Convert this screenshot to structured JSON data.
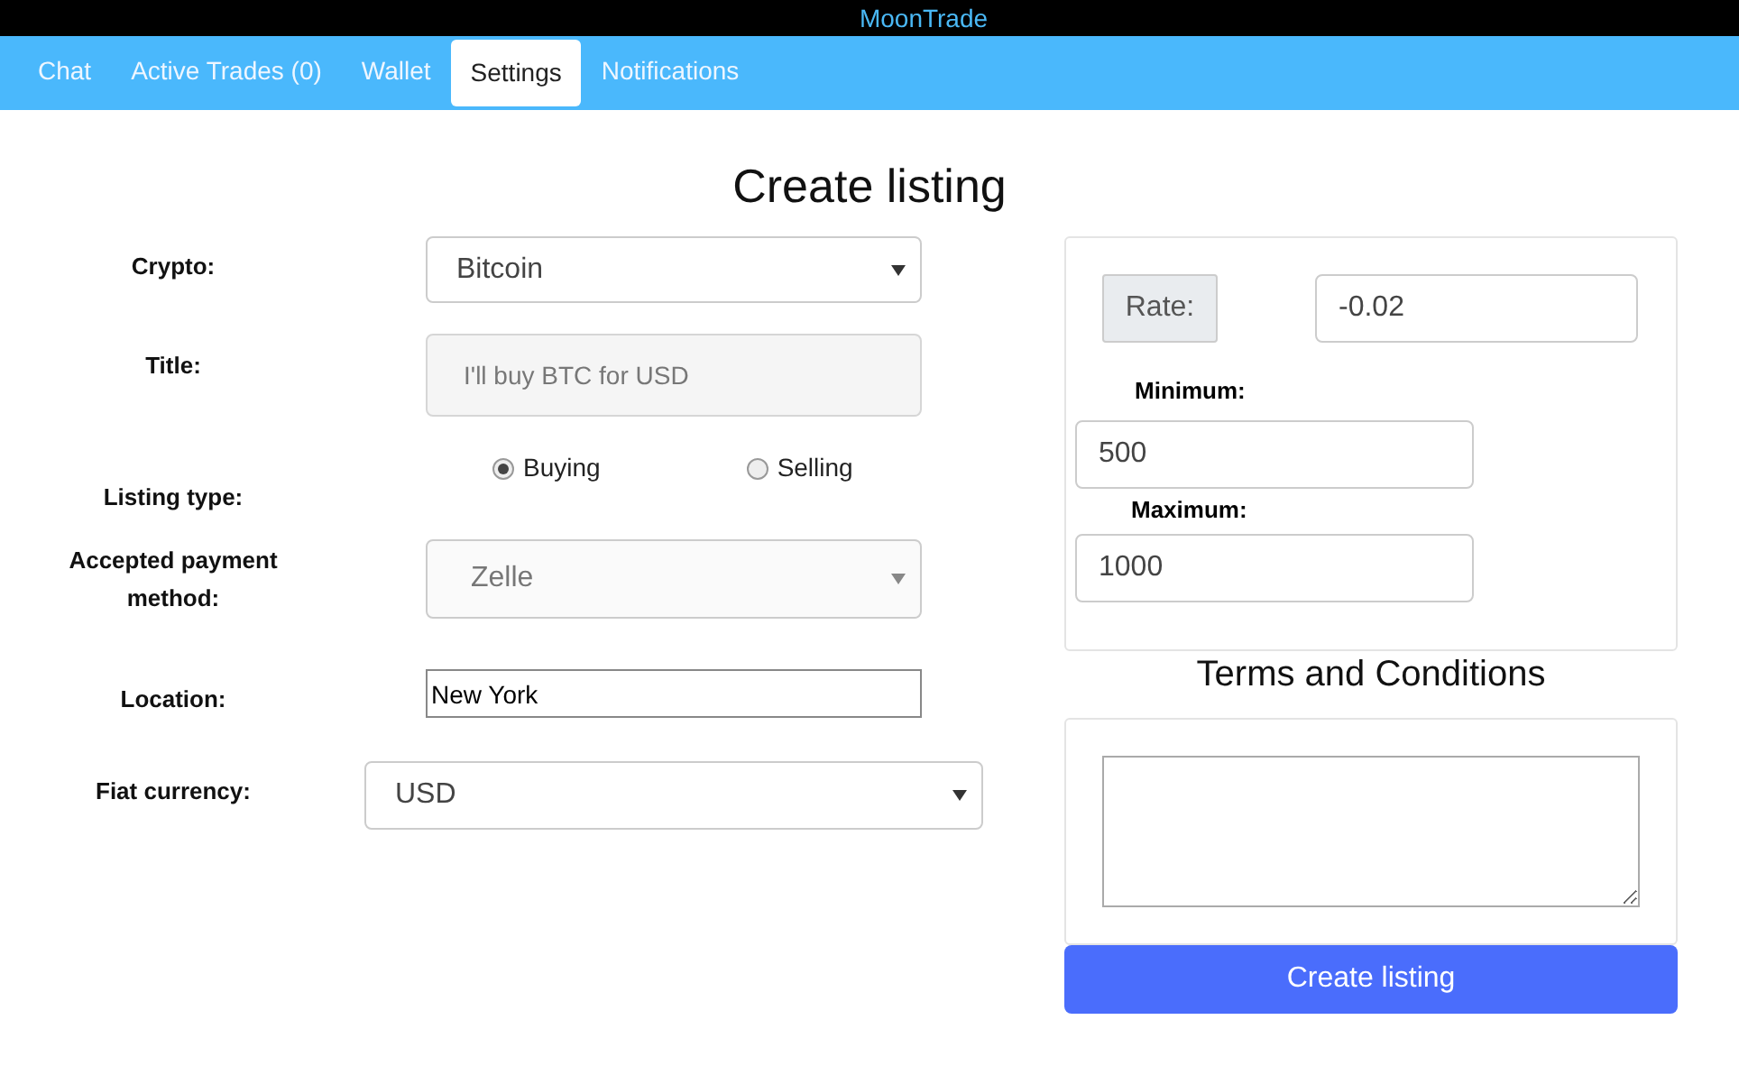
{
  "app_title": "MoonTrade",
  "tabs": [
    {
      "label": "Chat",
      "selected": false
    },
    {
      "label": "Active Trades (0)",
      "selected": false
    },
    {
      "label": "Wallet",
      "selected": false
    },
    {
      "label": "Settings",
      "selected": true
    },
    {
      "label": "Notifications",
      "selected": false
    }
  ],
  "heading": "Create listing",
  "form": {
    "crypto": {
      "label": "Crypto:",
      "value": "Bitcoin",
      "disabled": false
    },
    "title": {
      "label": "Title:",
      "placeholder": "I'll buy BTC for USD",
      "disabled": true
    },
    "listing_type": {
      "label": "Listing type:",
      "options": [
        {
          "label": "Buying",
          "selected": true
        },
        {
          "label": "Selling",
          "selected": false
        }
      ]
    },
    "payment_method": {
      "label": "Accepted payment method:",
      "value": "Zelle",
      "disabled": true
    },
    "location": {
      "label": "Location:",
      "value": "New York"
    },
    "fiat_currency": {
      "label": "Fiat currency:",
      "value": "USD",
      "disabled": false
    }
  },
  "limits": {
    "rate_label": "Rate:",
    "rate": "-0.02",
    "minimum_label": "Minimum:",
    "minimum": "500",
    "maximum_label": "Maximum:",
    "maximum": "1000"
  },
  "terms": {
    "heading": "Terms and Conditions"
  },
  "submit_button": "Create listing"
}
